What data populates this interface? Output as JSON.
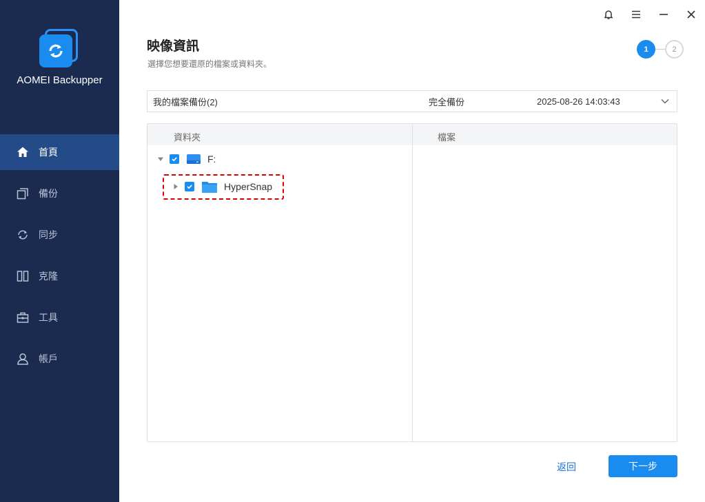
{
  "app": {
    "name": "AOMEI Backupper"
  },
  "sidebar": {
    "items": [
      {
        "label": "首頁",
        "icon": "home-icon",
        "active": true
      },
      {
        "label": "備份",
        "icon": "backup-icon",
        "active": false
      },
      {
        "label": "同步",
        "icon": "sync-icon",
        "active": false
      },
      {
        "label": "克隆",
        "icon": "clone-icon",
        "active": false
      },
      {
        "label": "工具",
        "icon": "toolbox-icon",
        "active": false
      },
      {
        "label": "帳戶",
        "icon": "user-icon",
        "active": false
      }
    ]
  },
  "titlebar": {
    "icons": [
      "bell-icon",
      "menu-icon",
      "minimize-icon",
      "close-icon"
    ]
  },
  "page": {
    "title": "映像資訊",
    "subtitle": "選擇您想要還原的檔案或資料夾。"
  },
  "steps": {
    "current": "1",
    "next": "2"
  },
  "backup": {
    "name": "我的檔案備份(2)",
    "type": "完全備份",
    "date": "2025-08-26 14:03:43"
  },
  "panel": {
    "folder_header": "資料夾",
    "files_header": "檔案",
    "tree": [
      {
        "label": "F:",
        "checked": true,
        "expanded": true,
        "icon": "drive-icon"
      },
      {
        "label": "HyperSnap",
        "checked": true,
        "expanded": false,
        "icon": "folder-icon"
      }
    ]
  },
  "footer": {
    "back_label": "返回",
    "next_label": "下一步"
  },
  "colors": {
    "accent": "#1a8cf0",
    "sidebar": "#1b2b4f",
    "sidebar_active": "#234b87",
    "highlight": "#d90000"
  }
}
